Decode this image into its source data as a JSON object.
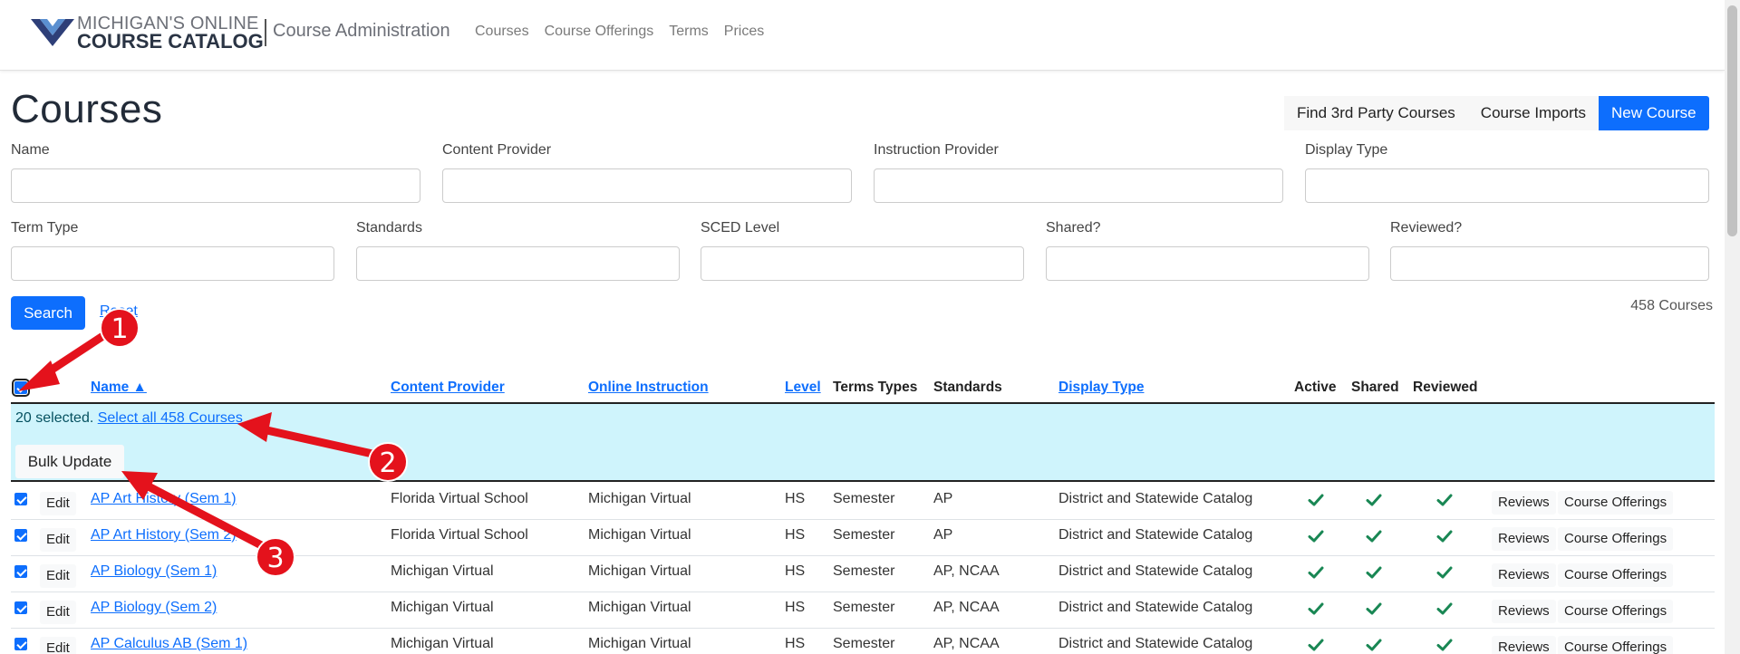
{
  "header": {
    "logo_line1": "MICHIGAN'S ONLINE",
    "logo_line2": "COURSE CATALOG",
    "app_title": "Course Administration",
    "nav": [
      "Courses",
      "Course Offerings",
      "Terms",
      "Prices"
    ]
  },
  "page": {
    "title": "Courses",
    "actions": [
      "Find 3rd Party Courses",
      "Course Imports",
      "New Course"
    ]
  },
  "filters": {
    "row1": [
      "Name",
      "Content Provider",
      "Instruction Provider",
      "Display Type"
    ],
    "row2": [
      "Term Type",
      "Standards",
      "SCED Level",
      "Shared?",
      "Reviewed?"
    ],
    "search_label": "Search",
    "reset_label": "Reset",
    "result_count": "458 Courses"
  },
  "table": {
    "columns": [
      "Name ▲",
      "Content Provider",
      "Online Instruction",
      "Level",
      "Terms Types",
      "Standards",
      "Display Type",
      "Active",
      "Shared",
      "Reviewed"
    ],
    "selection": {
      "selected_text": "20 selected.",
      "select_all_link": "Select all 458 Courses",
      "bulk_button": "Bulk Update"
    },
    "edit_label": "Edit",
    "reviews_label": "Reviews",
    "offerings_label": "Course Offerings",
    "rows": [
      {
        "name": "AP Art History (Sem 1)",
        "content_provider": "Florida Virtual School",
        "instruction": "Michigan Virtual",
        "level": "HS",
        "term": "Semester",
        "standards": "AP",
        "display": "District and Statewide Catalog"
      },
      {
        "name": "AP Art History (Sem 2)",
        "content_provider": "Florida Virtual School",
        "instruction": "Michigan Virtual",
        "level": "HS",
        "term": "Semester",
        "standards": "AP",
        "display": "District and Statewide Catalog"
      },
      {
        "name": "AP Biology (Sem 1)",
        "content_provider": "Michigan Virtual",
        "instruction": "Michigan Virtual",
        "level": "HS",
        "term": "Semester",
        "standards": "AP, NCAA",
        "display": "District and Statewide Catalog"
      },
      {
        "name": "AP Biology (Sem 2)",
        "content_provider": "Michigan Virtual",
        "instruction": "Michigan Virtual",
        "level": "HS",
        "term": "Semester",
        "standards": "AP, NCAA",
        "display": "District and Statewide Catalog"
      },
      {
        "name": "AP Calculus AB (Sem 1)",
        "content_provider": "Michigan Virtual",
        "instruction": "Michigan Virtual",
        "level": "HS",
        "term": "Semester",
        "standards": "AP, NCAA",
        "display": "District and Statewide Catalog"
      }
    ]
  },
  "annotations": [
    "1",
    "2",
    "3"
  ],
  "colors": {
    "primary": "#0d6efd",
    "info_bg": "#cff4fc",
    "check": "#198754",
    "annotation": "#e4121c"
  }
}
